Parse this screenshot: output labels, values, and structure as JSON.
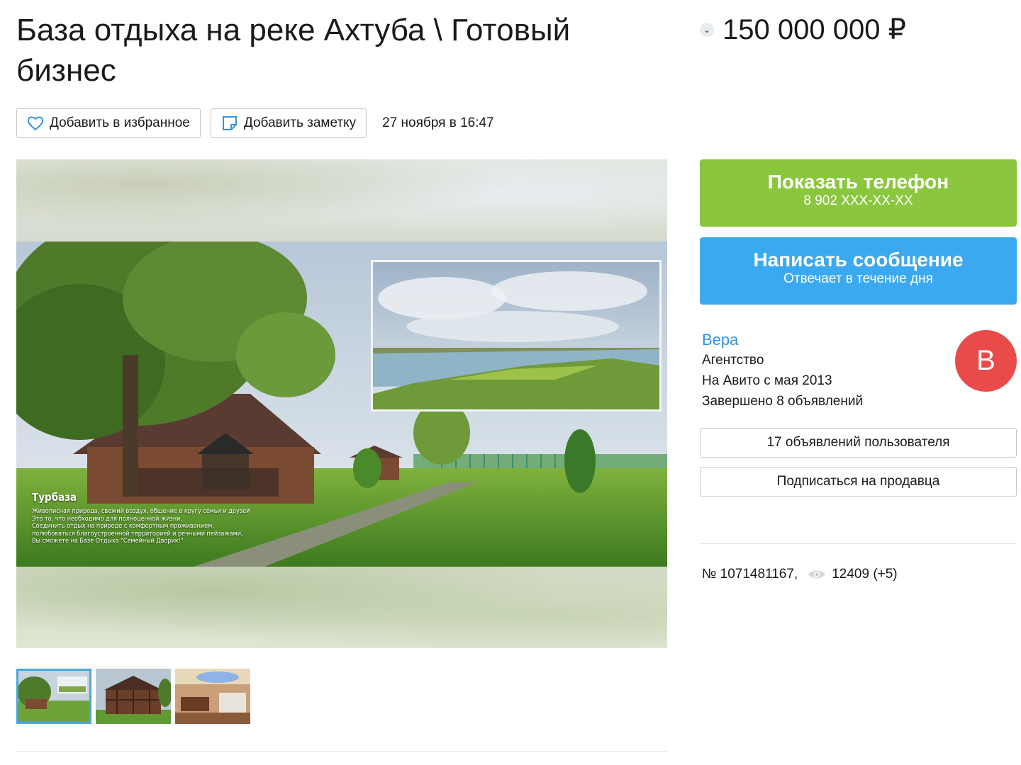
{
  "listing": {
    "title": "База отдыха на реке Ахтуба \\ Готовый бизнес",
    "price": "150 000 000 ₽",
    "date": "27 ноября в 16:47",
    "id_text": "№ 1071481167,",
    "views": "12409 (+5)"
  },
  "actions": {
    "favorite_label": "Добавить в избранное",
    "note_label": "Добавить заметку"
  },
  "photo": {
    "overlay_heading": "Турбаза",
    "overlay_lines": [
      "Живописная природа, свежий воздух, общение в кругу семьи и друзей",
      "Это то, что необходимо для полноценной жизни.",
      "Соединить отдых на природе с комфортным проживанием,",
      "полюбоваться благоустроенной территорией и речными пейзажами,",
      "Вы сможете на Базе Отдыха \"Семейный Дворик!\""
    ]
  },
  "contact": {
    "phone_label": "Показать телефон",
    "phone_masked": "8 902 XXX-XX-XX",
    "message_label": "Написать сообщение",
    "message_sub": "Отвечает в течение дня"
  },
  "seller": {
    "name": "Вера",
    "type": "Агентство",
    "since": "На Авито с мая 2013",
    "completed": "Завершено 8 объявлений",
    "avatar_letter": "В",
    "avatar_color": "#e94b4b",
    "listings_button": "17 объявлений пользователя",
    "subscribe_button": "Подписаться на продавца"
  },
  "colors": {
    "phone_button": "#8bc63f",
    "message_button": "#3ba9f0",
    "link": "#3592e0"
  }
}
